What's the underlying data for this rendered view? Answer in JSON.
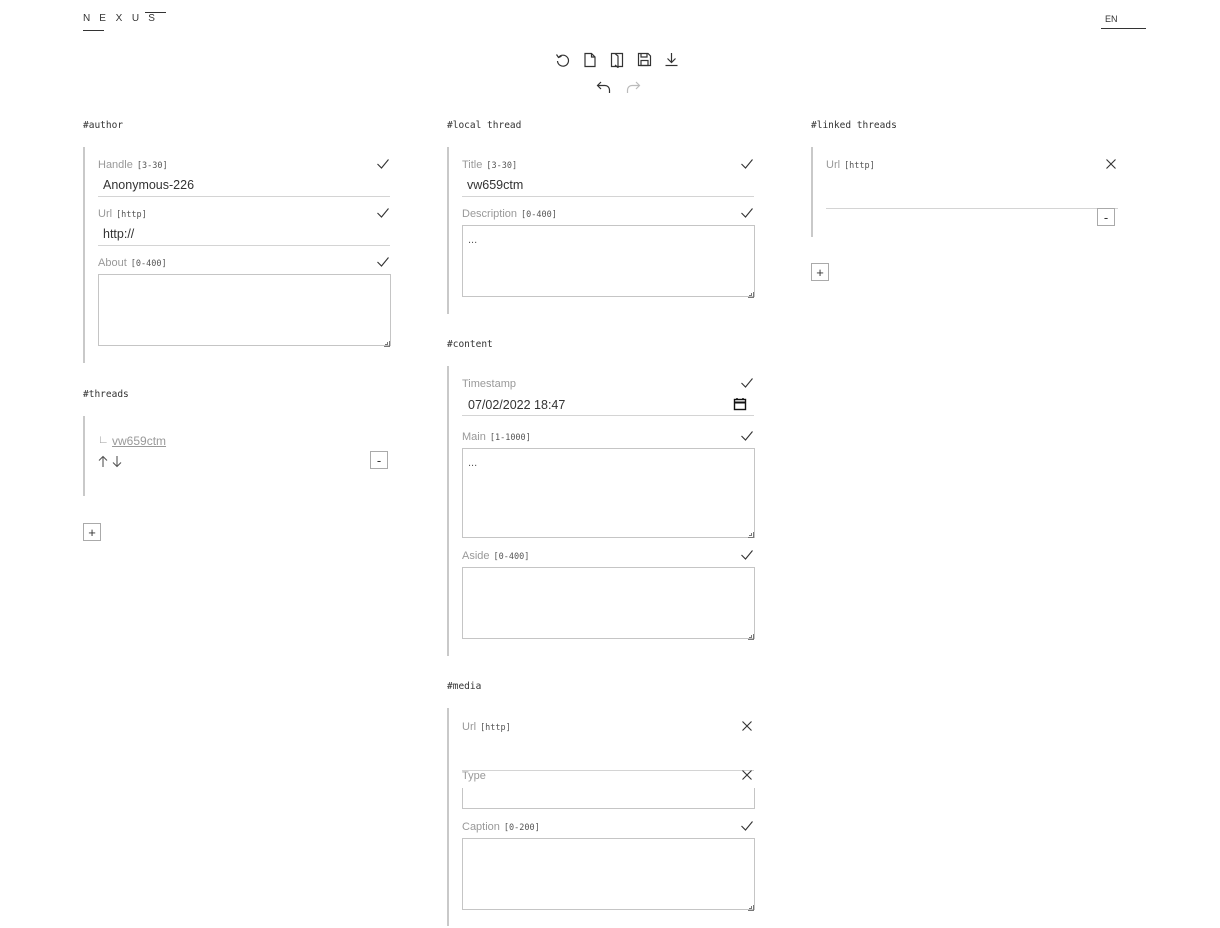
{
  "brand": {
    "logo_letters": [
      "N",
      "E",
      "X",
      "U",
      "S"
    ]
  },
  "language": "EN",
  "toolbar": {
    "icons": [
      "reset-icon",
      "new-file-icon",
      "open-book-icon",
      "save-icon",
      "download-icon"
    ],
    "history_icons": [
      "undo-icon",
      "redo-icon"
    ]
  },
  "author": {
    "heading": "author",
    "handle": {
      "label": "Handle",
      "range": "[3-30]",
      "value": "Anonymous-226"
    },
    "url": {
      "label": "Url",
      "range": "[http]",
      "value": "http://"
    },
    "about": {
      "label": "About",
      "range": "[0-400]",
      "value": ""
    }
  },
  "threads": {
    "heading": "threads",
    "branch_glyph": "∟",
    "items": [
      {
        "title": "vw659ctm"
      }
    ],
    "remove_label": "-",
    "add_label": "+"
  },
  "local_thread": {
    "heading": "local thread",
    "title": {
      "label": "Title",
      "range": "[3-30]",
      "value": "vw659ctm"
    },
    "description": {
      "label": "Description",
      "range": "[0-400]",
      "value": "..."
    }
  },
  "content": {
    "heading": "content",
    "timestamp": {
      "label": "Timestamp",
      "value": "07/02/2022 18:47"
    },
    "main": {
      "label": "Main",
      "range": "[1-1000]",
      "value": "..."
    },
    "aside": {
      "label": "Aside",
      "range": "[0-400]",
      "value": ""
    }
  },
  "media": {
    "heading": "media",
    "url": {
      "label": "Url",
      "range": "[http]",
      "value": ""
    },
    "type": {
      "label": "Type",
      "value": ""
    },
    "caption": {
      "label": "Caption",
      "range": "[0-200]",
      "value": ""
    }
  },
  "linked_threads": {
    "heading": "linked threads",
    "url": {
      "label": "Url",
      "range": "[http]",
      "value": ""
    },
    "remove_label": "-",
    "add_label": "+"
  }
}
